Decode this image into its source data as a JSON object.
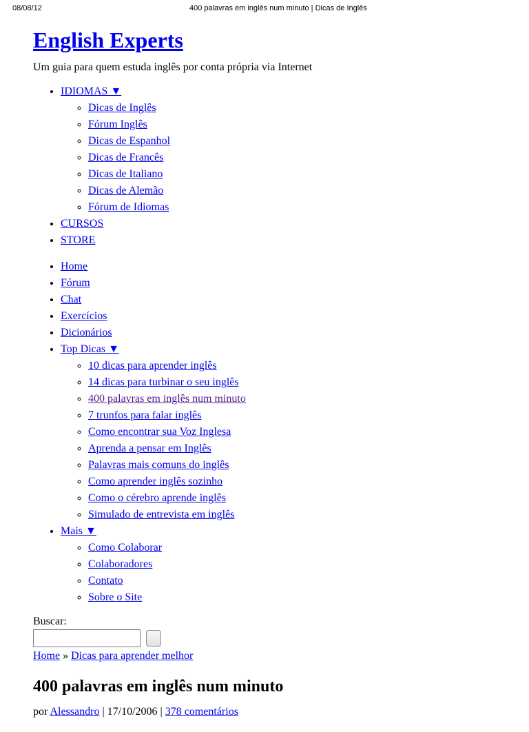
{
  "header": {
    "date": "08/08/12",
    "page_title": "400 palavras em inglês num minuto | Dicas de Inglês"
  },
  "site": {
    "title": "English Experts",
    "tagline": "Um guia para quem estuda inglês por conta própria via Internet"
  },
  "nav1": {
    "idiomas_label": "IDIOMAS ▼",
    "idiomas_items": [
      "Dicas de Inglês",
      "Fórum Inglês",
      "Dicas de Espanhol",
      "Dicas de Francês",
      "Dicas de Italiano",
      "Dicas de Alemão",
      "Fórum de Idiomas"
    ],
    "cursos_label": "CURSOS",
    "store_label": "STORE"
  },
  "nav2": {
    "home": "Home",
    "forum": "Fórum",
    "chat": "Chat",
    "exercicios": "Exercícios",
    "dicionarios": "Dicionários",
    "top_dicas_label": "Top Dicas ▼",
    "top_dicas_items": [
      "10 dicas para aprender inglês",
      "14 dicas para turbinar o seu inglês",
      "400 palavras em inglês num minuto",
      "7 trunfos para falar inglês",
      "Como encontrar sua Voz Inglesa",
      "Aprenda a pensar em Inglês",
      "Palavras mais comuns do inglês",
      "Como aprender inglês sozinho",
      "Como o cérebro aprende inglês",
      "Simulado de entrevista em inglês"
    ],
    "mais_label": "Mais ▼",
    "mais_items": [
      "Como Colaborar",
      "Colaboradores",
      "Contato",
      "Sobre o Site"
    ]
  },
  "search": {
    "label": "Buscar:"
  },
  "breadcrumb": {
    "home": "Home",
    "sep": " » ",
    "category": "Dicas para aprender melhor"
  },
  "article": {
    "title": "400 palavras em inglês num minuto",
    "by_prefix": "por ",
    "author": "Alessandro",
    "sep": " | ",
    "date": "17/10/2006",
    "comments": "378 comentários"
  }
}
